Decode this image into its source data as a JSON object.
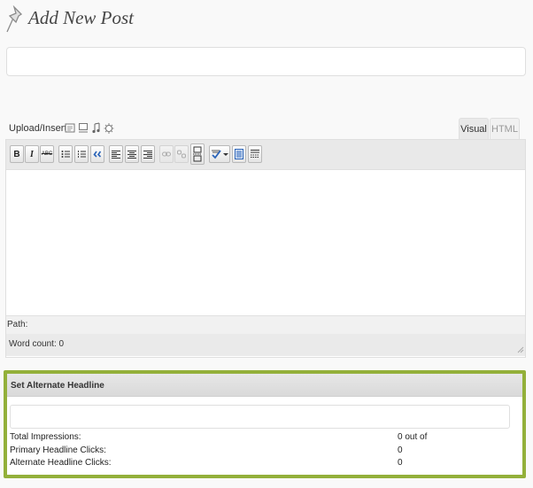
{
  "header": {
    "title": "Add New Post"
  },
  "title_input": {
    "value": "",
    "placeholder": ""
  },
  "media": {
    "label": "Upload/Insert",
    "icons": [
      "image-icon",
      "video-icon",
      "audio-icon",
      "media-icon"
    ]
  },
  "editor_tabs": [
    {
      "label": "Visual",
      "active": true
    },
    {
      "label": "HTML",
      "active": false
    }
  ],
  "toolbar": {
    "buttons": [
      "bold-icon",
      "italic-icon",
      "strikethrough-icon",
      "bullet-list-icon",
      "numbered-list-icon",
      "blockquote-icon",
      "align-left-icon",
      "align-center-icon",
      "align-right-icon",
      "link-icon",
      "unlink-icon",
      "more-tag-icon",
      "spellcheck-icon",
      "fullscreen-icon",
      "kitchen-sink-icon"
    ],
    "bold_label": "B",
    "italic_label": "I",
    "strike_label": "ABC"
  },
  "editor": {
    "content": "",
    "path_label": "Path:",
    "word_count": "Word count: 0"
  },
  "alternate_headline": {
    "title": "Set Alternate Headline",
    "input_value": "",
    "stats": [
      {
        "label": "Total Impressions:",
        "value": "0 out of"
      },
      {
        "label": "Primary Headline Clicks:",
        "value": "0"
      },
      {
        "label": "Alternate Headline Clicks:",
        "value": "0"
      }
    ]
  },
  "colors": {
    "accent_border": "#93b03a",
    "toolbar_bg": "#e9e9e9"
  }
}
